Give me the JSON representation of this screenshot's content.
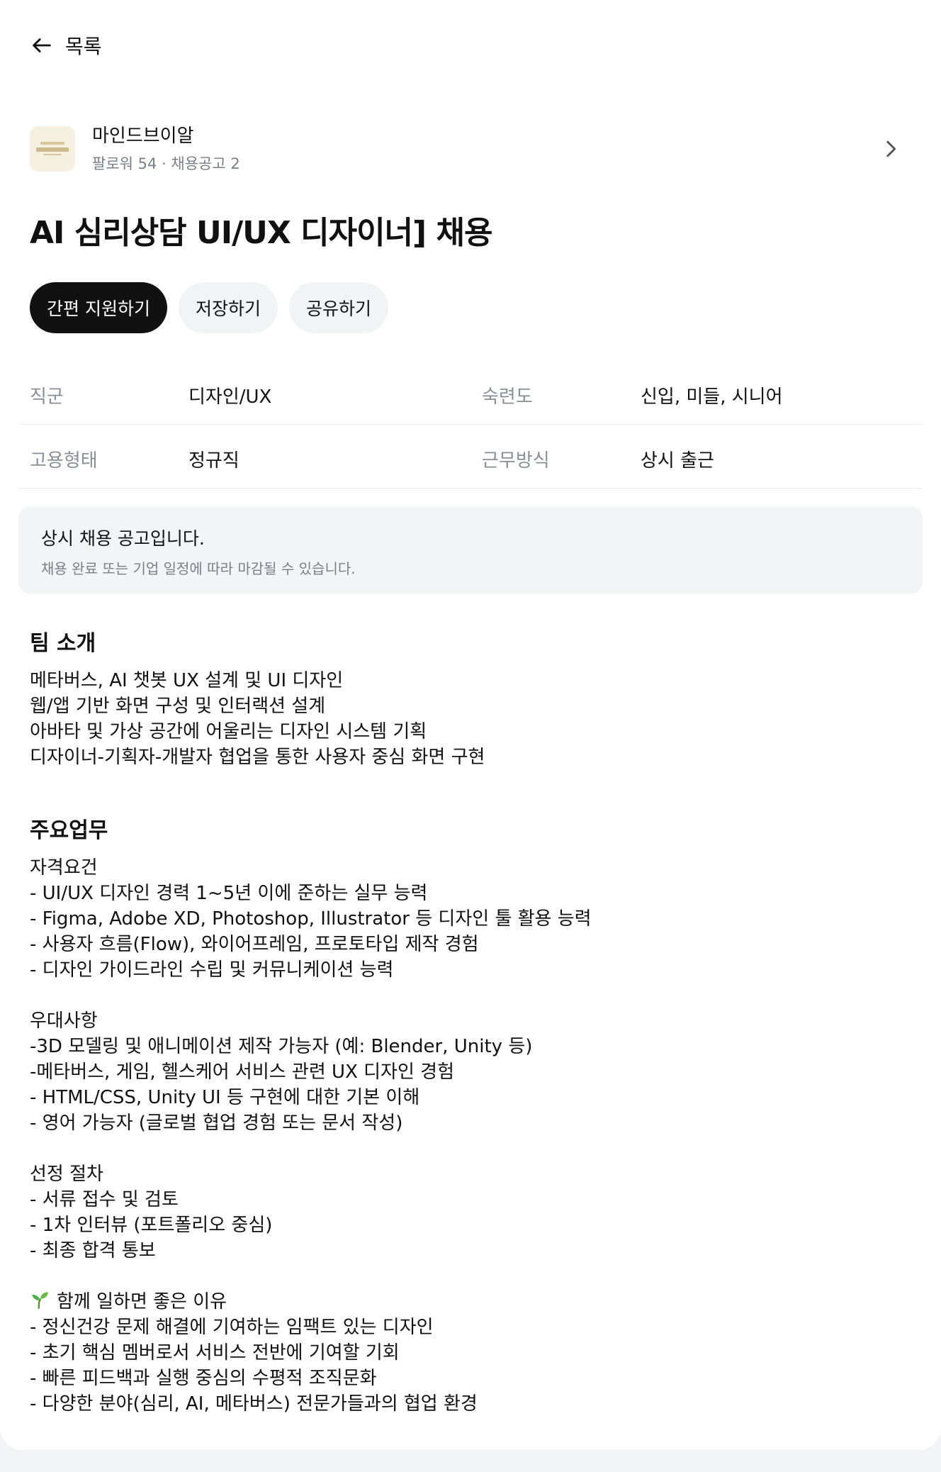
{
  "nav": {
    "back_label": "목록"
  },
  "company": {
    "name": "마인드브이알",
    "meta": "팔로워 54 · 채용공고 2"
  },
  "job": {
    "title": "AI 심리상담 UI/UX 디자이너] 채용"
  },
  "actions": {
    "apply": "간편 지원하기",
    "save": "저장하기",
    "share": "공유하기"
  },
  "details": {
    "row1": {
      "k1": "직군",
      "v1": "디자인/UX",
      "k2": "숙련도",
      "v2": "신입, 미들, 시니어"
    },
    "row2": {
      "k1": "고용형태",
      "v1": "정규직",
      "k2": "근무방식",
      "v2": "상시 출근"
    }
  },
  "notice": {
    "title": "상시 채용 공고입니다.",
    "subtitle": "채용 완료 또는 기업 일정에 따라 마감될 수 있습니다."
  },
  "team": {
    "heading": "팀 소개",
    "lines": [
      "메타버스, AI 챗봇 UX 설계 및 UI 디자인",
      "웹/앱 기반 화면 구성 및 인터랙션 설계",
      "아바타 및 가상 공간에 어울리는 디자인 시스템 기획",
      "디자이너-기획자-개발자 협업을 통한 사용자 중심 화면 구현"
    ]
  },
  "duties": {
    "heading": "주요업무",
    "qualifications": [
      "자격요건",
      "- UI/UX 디자인 경력 1~5년 이에 준하는 실무 능력",
      "- Figma, Adobe XD, Photoshop, Illustrator 등 디자인 툴 활용 능력",
      "- 사용자 흐름(Flow), 와이어프레임, 프로토타입 제작 경험",
      "- 디자인 가이드라인 수립 및 커뮤니케이션 능력"
    ],
    "preferred": [
      "우대사항",
      "-3D 모델링 및 애니메이션 제작 가능자 (예: Blender, Unity 등)",
      "-메타버스, 게임, 헬스케어 서비스 관련 UX 디자인 경험",
      "- HTML/CSS, Unity UI 등 구현에 대한 기본 이해",
      "- 영어 가능자 (글로벌 협업 경험 또는 문서 작성)"
    ],
    "process": [
      "선정 절차",
      "- 서류 접수 및 검토",
      "- 1차 인터뷰 (포트폴리오 중심)",
      "- 최종 합격 통보"
    ],
    "why_heading": "함께 일하면 좋은 이유",
    "why": [
      "- 정신건강 문제 해결에 기여하는 임팩트 있는 디자인",
      "- 초기 핵심 멤버로서 서비스 전반에 기여할 기회",
      "- 빠른 피드백과 실행 중심의 수평적 조직문화",
      "- 다양한 분야(심리, AI, 메타버스) 전문가들과의 협업 환경"
    ]
  },
  "colors": {
    "primary_button": "#111111",
    "secondary_button": "#f2f3f5",
    "muted_text": "#8a8e96",
    "notice_bg": "#f3f4f6",
    "sprout": "#4caf50"
  },
  "icons": {
    "back": "arrow-left-icon",
    "company_link": "chevron-right-icon",
    "why": "sprout-icon"
  }
}
